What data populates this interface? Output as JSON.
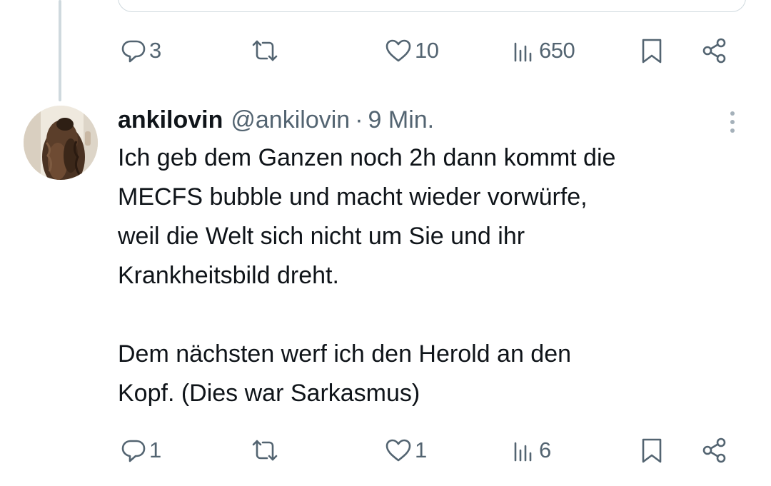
{
  "parent_tweet": {
    "actions": {
      "reply_count": "3",
      "retweet_count": "",
      "like_count": "10",
      "view_count": "650"
    }
  },
  "reply_tweet": {
    "author_name": "ankilovin",
    "author_handle": "@ankilovin",
    "separator": "·",
    "timestamp": "9 Min.",
    "text": "Ich geb dem Ganzen noch 2h dann kommt die\nMECFS bubble und macht wieder vorwürfe,\nweil die Welt sich nicht um Sie und ihr\nKrankheitsbild dreht.\n\nDem nächsten werf ich den Herold an den\nKopf. (Dies war Sarkasmus)",
    "actions": {
      "reply_count": "1",
      "retweet_count": "",
      "like_count": "1",
      "view_count": "6"
    }
  },
  "icons": {
    "reply": "reply-icon",
    "retweet": "retweet-icon",
    "like": "heart-icon",
    "views": "views-bar-chart-icon",
    "bookmark": "bookmark-icon",
    "share": "share-icon",
    "more": "more-vertical-icon"
  },
  "colors": {
    "text_primary": "#0f1419",
    "text_secondary": "#536471",
    "thread_line": "#cfd9de",
    "more_dots": "#a5b1ba"
  }
}
